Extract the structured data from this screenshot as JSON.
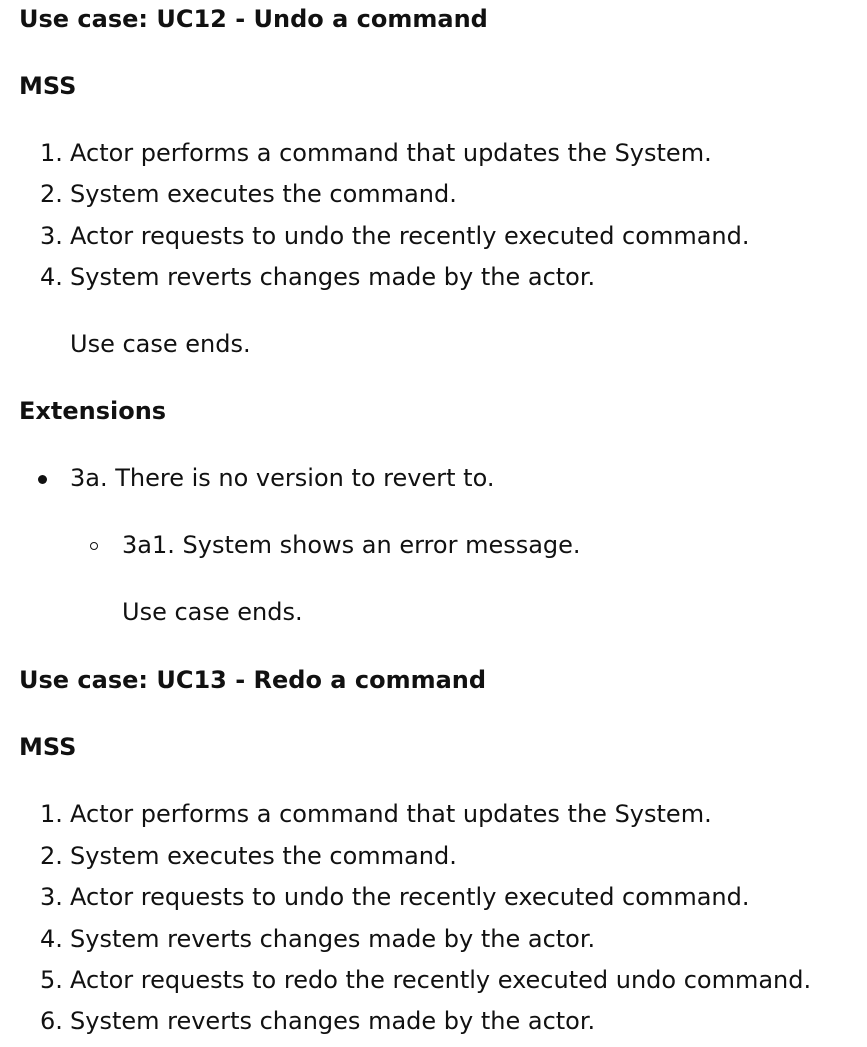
{
  "uc12": {
    "title": "Use case: UC12 - Undo a command",
    "mss_label": "MSS",
    "steps": [
      {
        "num": "1.",
        "text": "Actor performs a command that updates the System."
      },
      {
        "num": "2.",
        "text": "System executes the command."
      },
      {
        "num": "3.",
        "text": "Actor requests to undo the recently executed command."
      },
      {
        "num": "4.",
        "text": "System reverts changes made by the actor."
      }
    ],
    "end_note": "Use case ends.",
    "extensions_label": "Extensions",
    "extensions": [
      {
        "text": "3a. There is no version to revert to.",
        "sub": [
          {
            "text": "3a1. System shows an error message.",
            "end_note": "Use case ends."
          }
        ]
      }
    ]
  },
  "uc13": {
    "title": "Use case: UC13 - Redo a command",
    "mss_label": "MSS",
    "steps": [
      {
        "num": "1.",
        "text": "Actor performs a command that updates the System."
      },
      {
        "num": "2.",
        "text": "System executes the command."
      },
      {
        "num": "3.",
        "text": "Actor requests to undo the recently executed command."
      },
      {
        "num": "4.",
        "text": "System reverts changes made by the actor."
      },
      {
        "num": "5.",
        "text": "Actor requests to redo the recently executed undo command."
      },
      {
        "num": "6.",
        "text": "System reverts changes made by the actor."
      }
    ]
  }
}
